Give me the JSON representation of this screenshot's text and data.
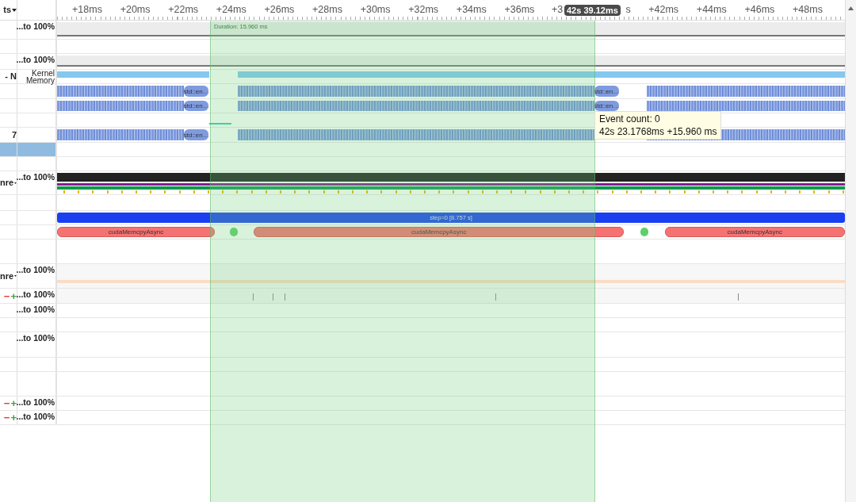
{
  "header": {
    "column_label": "ts",
    "ruler_ticks": [
      {
        "label": "+18ms"
      },
      {
        "label": "+20ms"
      },
      {
        "label": "+22ms"
      },
      {
        "label": "+24ms"
      },
      {
        "label": "+26ms"
      },
      {
        "label": "+28ms"
      },
      {
        "label": "+30ms"
      },
      {
        "label": "+32ms"
      },
      {
        "label": "+34ms"
      },
      {
        "label": "+36ms"
      },
      {
        "label": "+3"
      },
      {
        "label": "s"
      },
      {
        "label": "+42ms"
      },
      {
        "label": "+44ms"
      },
      {
        "label": "+46ms"
      },
      {
        "label": "+48ms"
      }
    ],
    "cursor_time": "42s 39.12ms"
  },
  "selection": {
    "duration": "Duration: 15.960 ms"
  },
  "tooltip": {
    "lines": [
      "Event count: 0",
      "42s 23.1768ms +15.960 ms"
    ]
  },
  "tracks": [
    {
      "kind": "counter",
      "scale": "...to 100%",
      "selected": false
    },
    {
      "kind": "blank",
      "selected": false
    },
    {
      "kind": "counter",
      "scale": "...to 100%",
      "selected": false
    },
    {
      "kind": "memory",
      "name": "- N",
      "scale": "Kernel Memory",
      "selected": false
    },
    {
      "kind": "slices",
      "labels": [
        "std::en…",
        "std::en…"
      ],
      "selected": false
    },
    {
      "kind": "slices",
      "labels": [
        "std::en…",
        "std::en…"
      ],
      "selected": false
    },
    {
      "kind": "sparse",
      "selected": false
    },
    {
      "kind": "slices",
      "name": "7",
      "labels": [
        "std::en…"
      ],
      "selected": false
    },
    {
      "kind": "blank",
      "selected": true
    },
    {
      "kind": "blank",
      "selected": false
    },
    {
      "kind": "cpu",
      "name": "nre",
      "expanded": true,
      "scale": "...to 100%",
      "selected": false
    },
    {
      "kind": "blank",
      "selected": false
    },
    {
      "kind": "step",
      "labels": [
        "step=0 [8.757 s]"
      ],
      "selected": false
    },
    {
      "kind": "api",
      "labels": [
        "cudaMemcpyAsync",
        "cudaMemcpyAsync",
        "cudaMemcpyAsync"
      ],
      "selected": false
    },
    {
      "kind": "blank",
      "selected": false
    },
    {
      "kind": "line",
      "name": "nre",
      "expanded": true,
      "scale": "...to 100%",
      "selected": false
    },
    {
      "kind": "marks",
      "zoom_buttons": [
        "−",
        "+"
      ],
      "scale": "...to 100%",
      "selected": false
    },
    {
      "kind": "blank",
      "scale": "...to 100%",
      "selected": false
    },
    {
      "kind": "blank",
      "selected": false
    },
    {
      "kind": "blank",
      "scale": "...to 100%",
      "selected": false
    },
    {
      "kind": "blank",
      "selected": false
    },
    {
      "kind": "blank",
      "selected": false
    },
    {
      "kind": "blank",
      "zoom_buttons": [
        "−",
        "+"
      ],
      "scale": "...to 100%",
      "selected": false
    },
    {
      "kind": "blank",
      "zoom_buttons": [
        "−",
        "+"
      ],
      "scale": "...to 100%",
      "selected": false
    }
  ]
}
